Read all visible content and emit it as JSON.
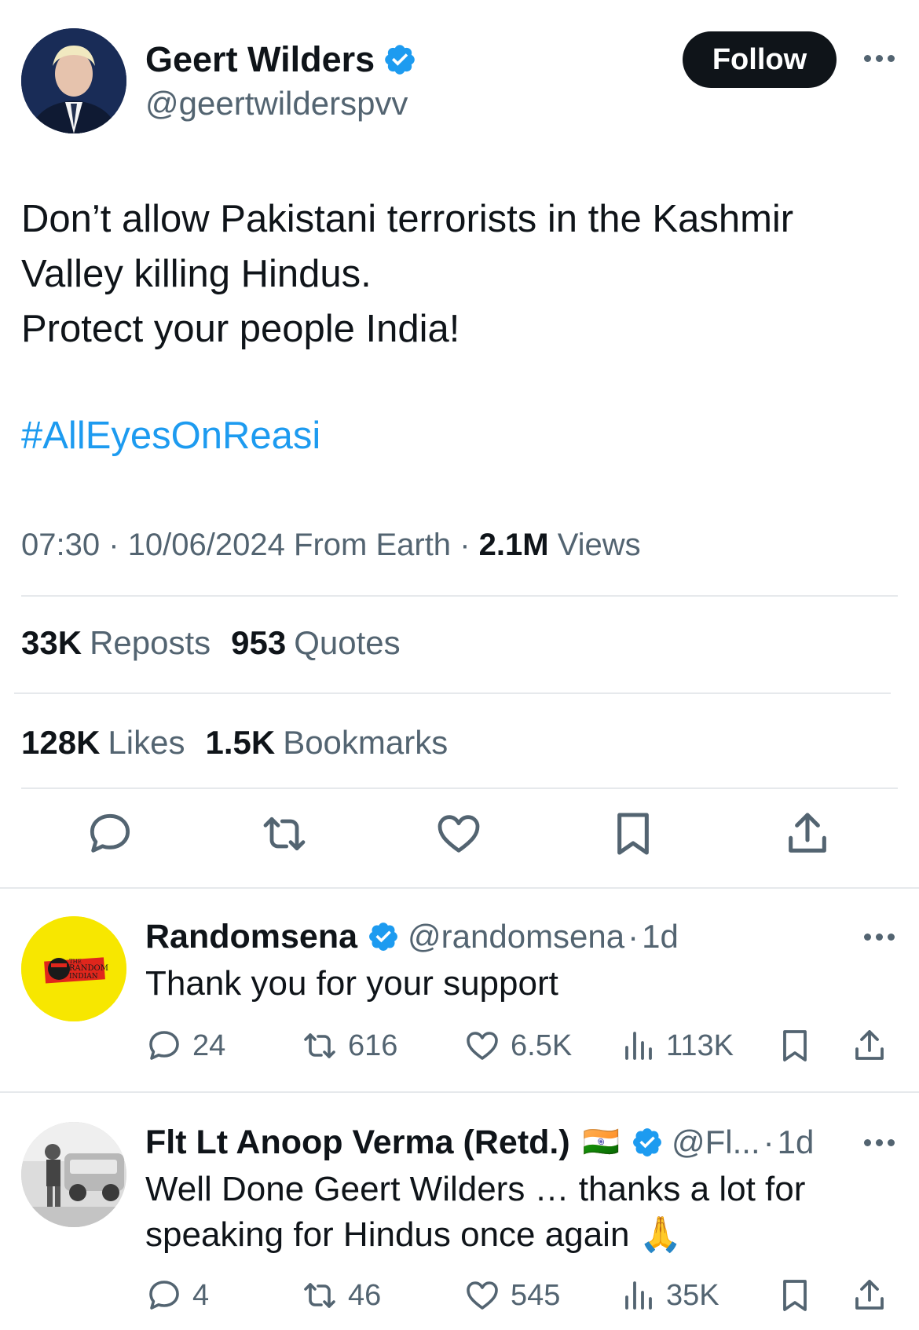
{
  "main_tweet": {
    "author": {
      "name": "Geert Wilders",
      "handle": "@geertwilderspvv",
      "verified": true
    },
    "follow_label": "Follow",
    "text_lines": [
      "Don’t allow Pakistani terrorists in the Kashmir",
      "Valley killing Hindus.",
      "Protect your people India!"
    ],
    "hashtag": "#AllEyesOnReasi",
    "time": "07:30",
    "date": "10/06/2024",
    "source": "From Earth",
    "views_count": "2.1M",
    "views_label": "Views",
    "reposts_count": "33K",
    "reposts_label": "Reposts",
    "quotes_count": "953",
    "quotes_label": "Quotes",
    "likes_count": "128K",
    "likes_label": "Likes",
    "bookmarks_count": "1.5K",
    "bookmarks_label": "Bookmarks",
    "actions": [
      "reply-icon",
      "repost-icon",
      "like-icon",
      "bookmark-icon",
      "share-icon"
    ]
  },
  "replies": [
    {
      "name": "Randomsena",
      "handle": "@randomsena",
      "age": "1d",
      "verified": true,
      "text_lines": [
        "Thank you for your support"
      ],
      "reply_count": "24",
      "repost_count": "616",
      "like_count": "6.5K",
      "views": "113K",
      "avatar_logo_text": [
        "THE",
        "RANDOM",
        "INDIAN"
      ]
    },
    {
      "name": "Flt Lt Anoop Verma (Retd.)",
      "flag": "🇮🇳",
      "handle": "@Fl...",
      "age": "1d",
      "verified": true,
      "text_lines": [
        "Well Done Geert Wilders … thanks a lot for",
        "speaking for Hindus once again 🙏"
      ],
      "reply_count": "4",
      "repost_count": "46",
      "like_count": "545",
      "views": "35K"
    }
  ],
  "separator": "·",
  "colors": {
    "text": "#0f1419",
    "secondary": "#536471",
    "link": "#1d9bf0",
    "verified": "#1d9bf0",
    "divider": "#e6e9ec",
    "follow_bg": "#0f1419"
  }
}
